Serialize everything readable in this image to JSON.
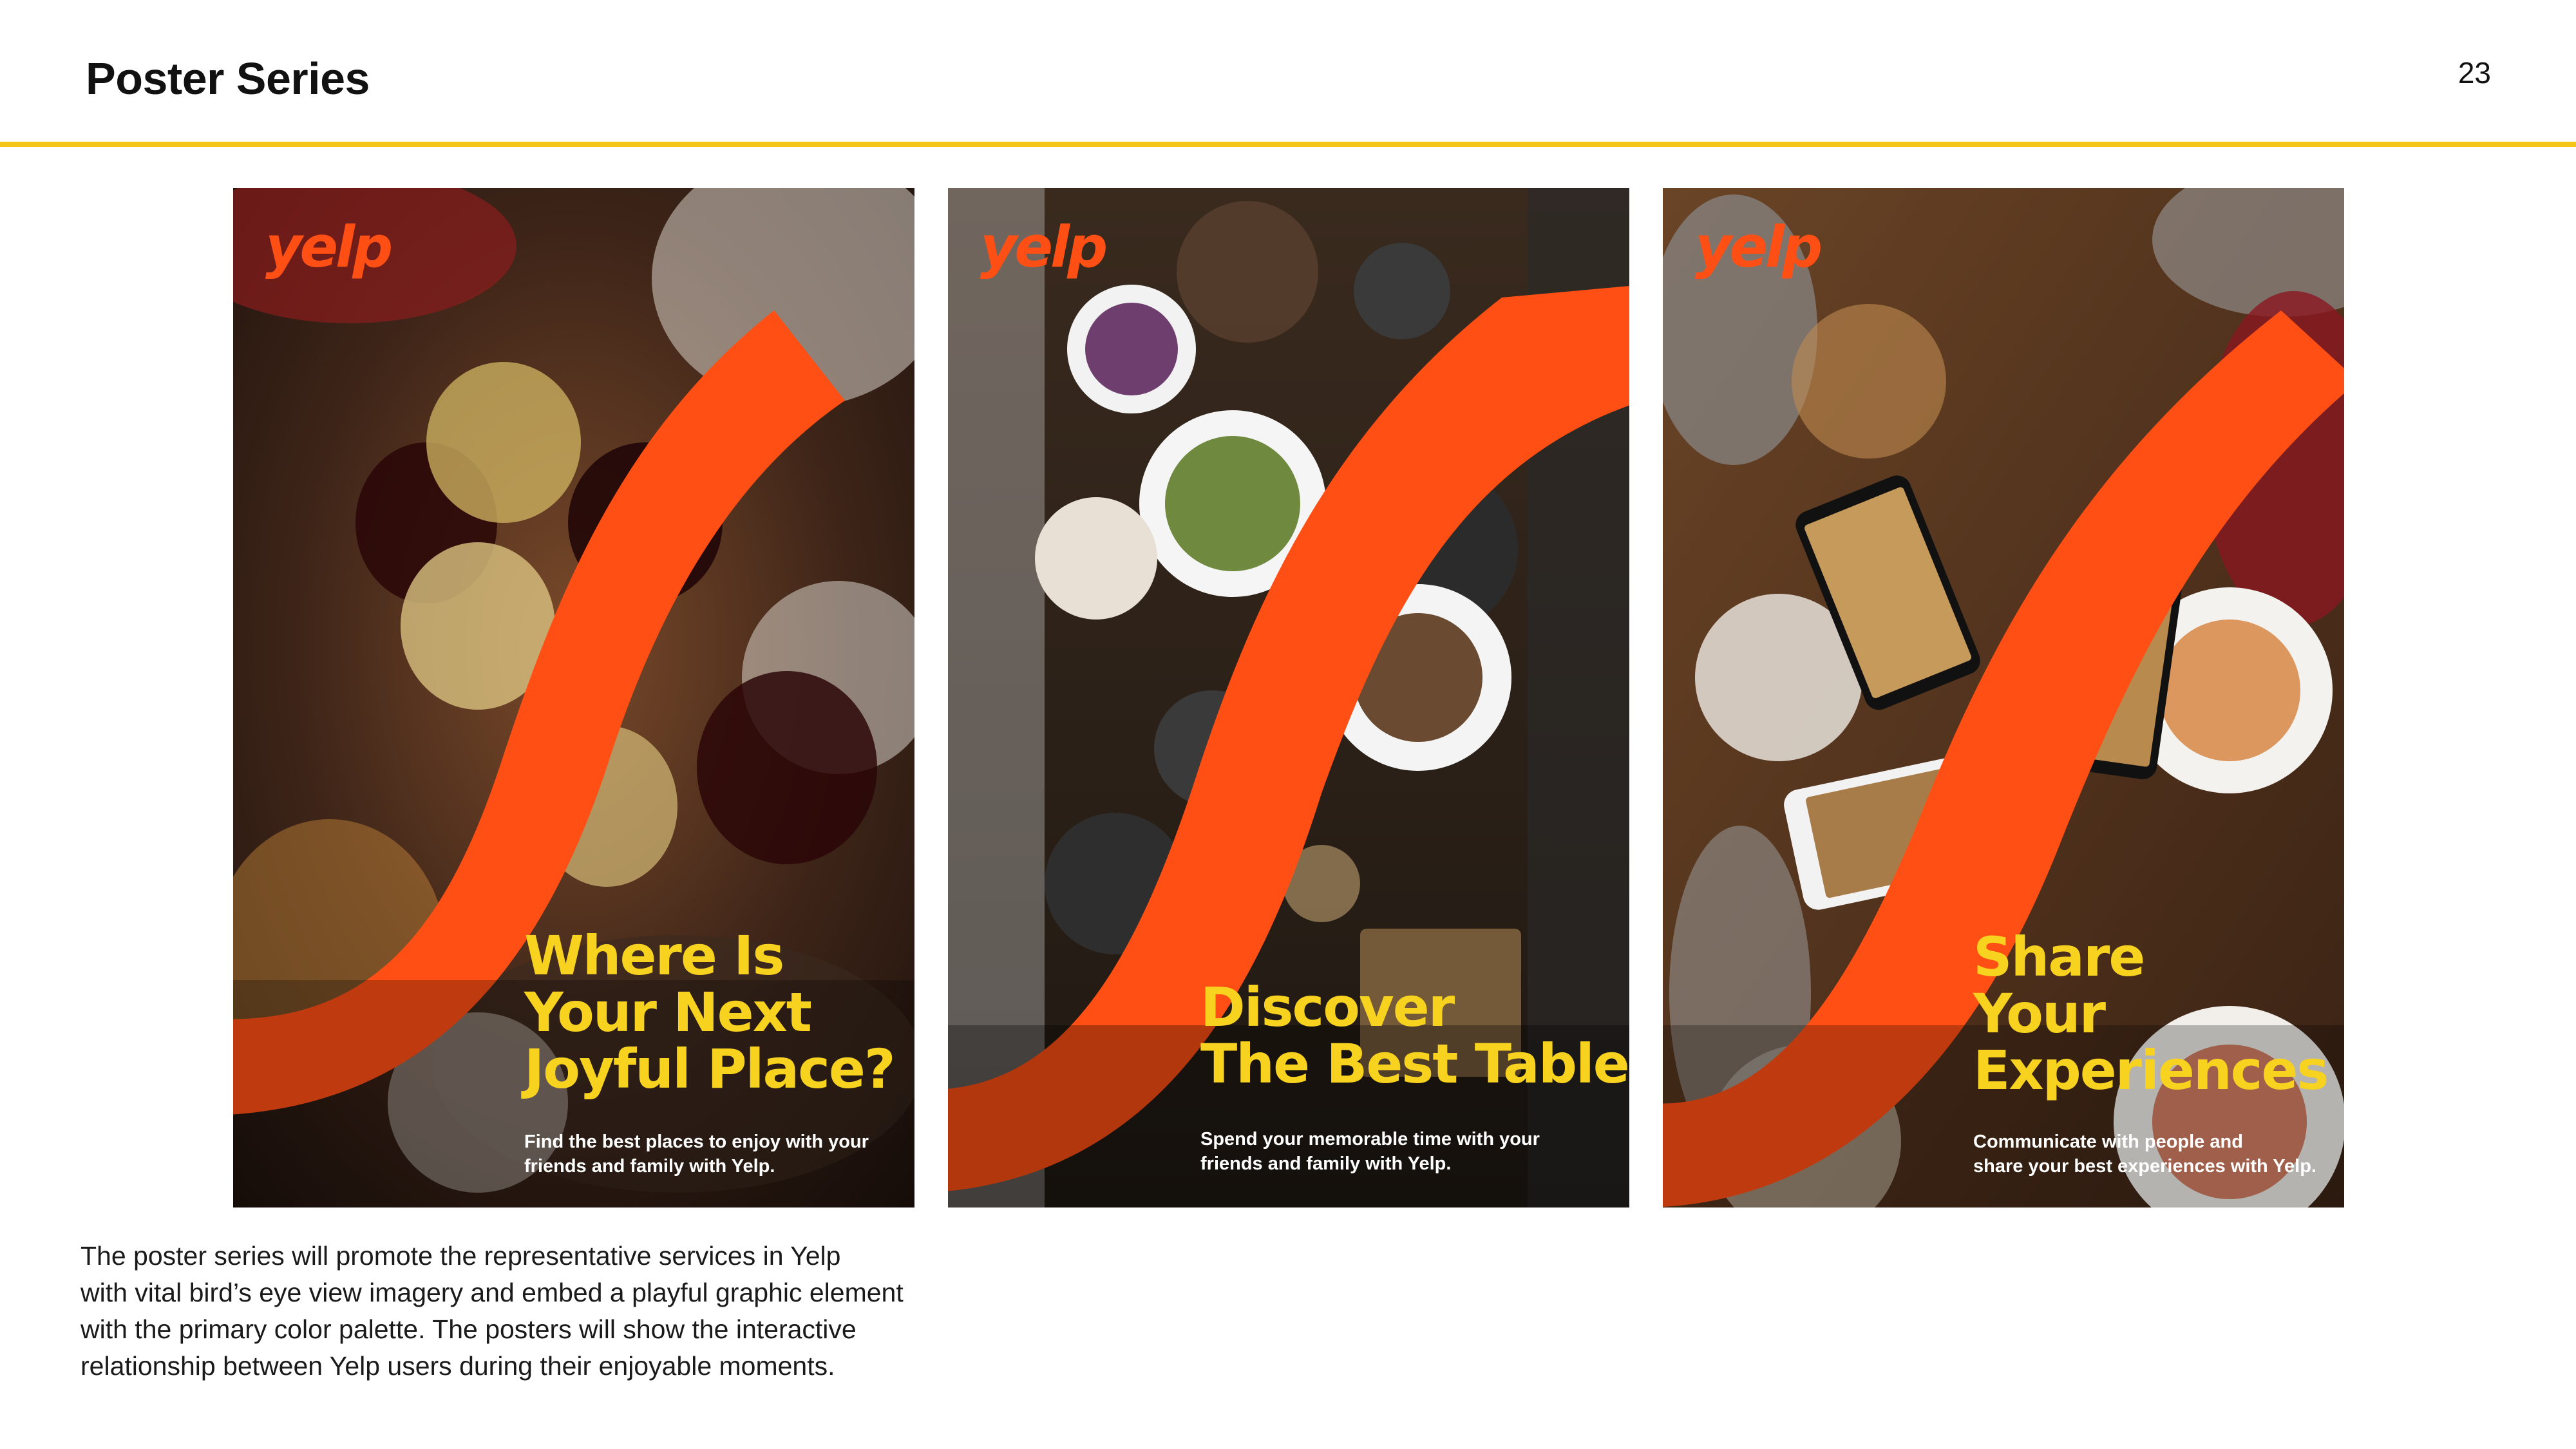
{
  "page": {
    "title": "Poster Series",
    "number": "23",
    "accent_color": "#f5c518"
  },
  "brand": {
    "logo_text": "yelp",
    "primary_color": "#ff4f14",
    "headline_color": "#f7d21f"
  },
  "posters": [
    {
      "headline": [
        "Where Is",
        "Your Next",
        "Joyful Place?"
      ],
      "tagline": [
        "Find the best places to enjoy with your",
        "friends and family with Yelp."
      ]
    },
    {
      "headline": [
        "Discover",
        "The Best Table"
      ],
      "tagline": [
        "Spend your memorable time with your",
        "friends and family with Yelp."
      ]
    },
    {
      "headline": [
        "Share",
        "Your",
        "Experiences"
      ],
      "tagline": [
        "Communicate with people and",
        "share your best experiences with Yelp."
      ]
    }
  ],
  "description": [
    "The poster series will promote the representative services in Yelp",
    "with vital bird’s eye view imagery and embed a playful graphic element",
    "with the primary color palette. The posters will show the interactive",
    "relationship between Yelp users during their enjoyable moments."
  ]
}
